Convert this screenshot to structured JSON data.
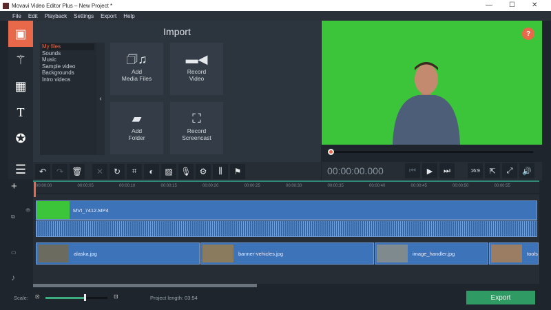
{
  "window": {
    "title": "Movavi Video Editor Plus – New Project *"
  },
  "menu": [
    "File",
    "Edit",
    "Playback",
    "Settings",
    "Export",
    "Help"
  ],
  "import": {
    "title": "Import",
    "categories": [
      "My files",
      "Sounds",
      "Music",
      "Sample video",
      "Backgrounds",
      "Intro videos"
    ],
    "tiles": [
      {
        "line1": "Add",
        "line2": "Media Files"
      },
      {
        "line1": "Record",
        "line2": "Video"
      },
      {
        "line1": "Add",
        "line2": "Folder"
      },
      {
        "line1": "Record",
        "line2": "Screencast"
      }
    ]
  },
  "preview": {
    "help": "?",
    "timecode": "00:00:00.000",
    "aspect": "16:9",
    "progress": 0
  },
  "ruler": [
    "00:00:00",
    "00:00:05",
    "00:00:10",
    "00:00:15",
    "00:00:20",
    "00:00:25",
    "00:00:30",
    "00:00:35",
    "00:00:40",
    "00:00:45",
    "00:00:50",
    "00:00:55"
  ],
  "timeline": {
    "video_clip": "MVI_7412.MP4",
    "image_clips": [
      "alaska.jpg",
      "banner-vehicles.jpg",
      "image_handler.jpg",
      "tools"
    ]
  },
  "footer": {
    "scale_label": "Scale:",
    "scale_value": 0.63,
    "project_length_label": "Project length:",
    "project_length": "03:54",
    "export": "Export"
  },
  "colors": {
    "accent": "#e8694a",
    "export": "#2f9a63",
    "clip": "#3d73b8",
    "chroma": "#3cc53a"
  }
}
